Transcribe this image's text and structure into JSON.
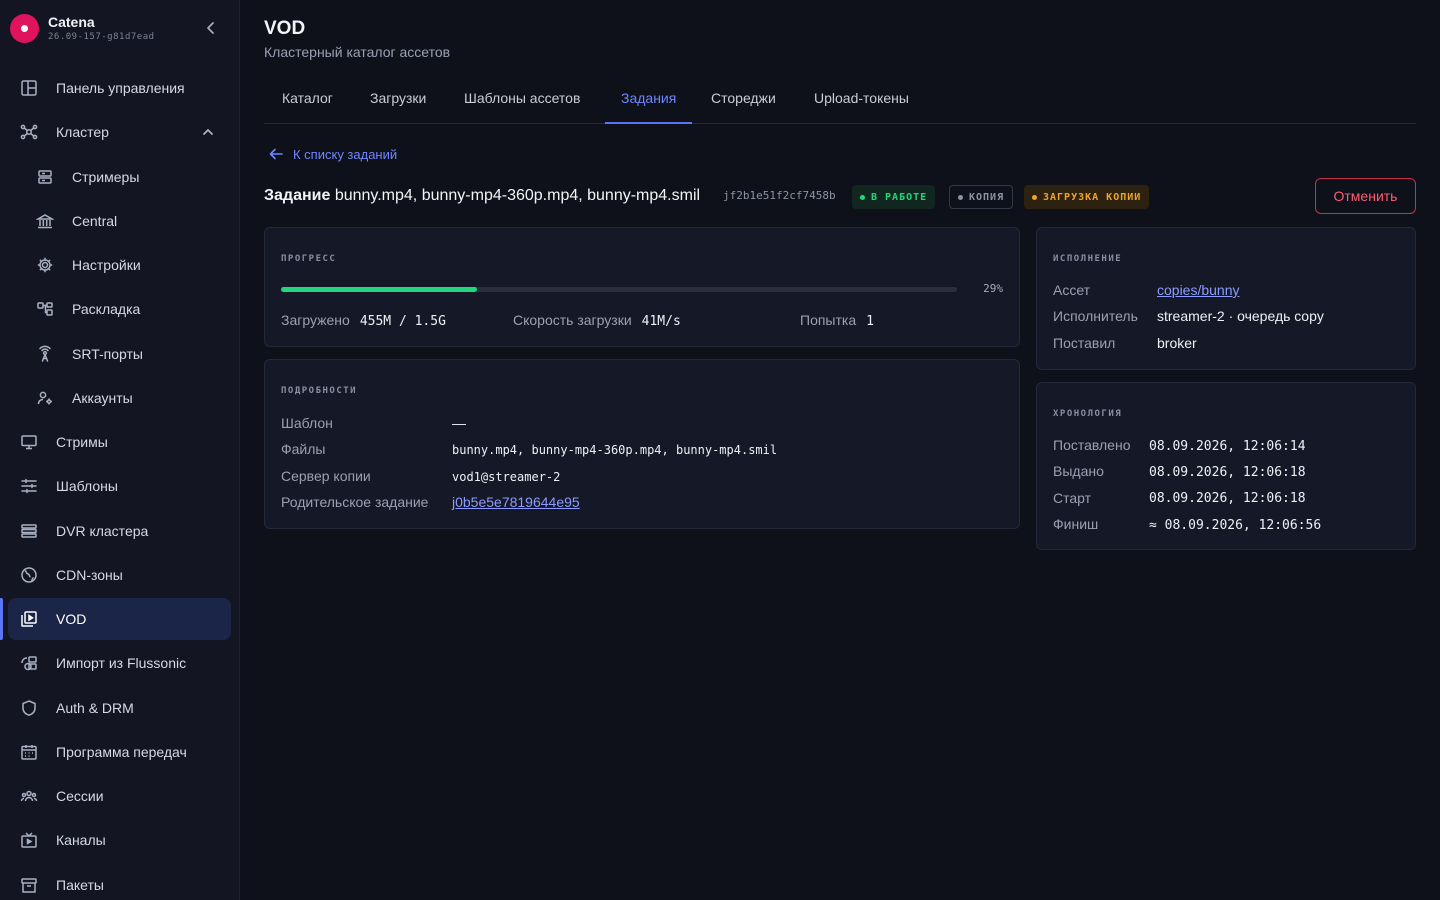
{
  "brand": {
    "name": "Catena",
    "version": "26.09-157-g81d7ead"
  },
  "sidebar": {
    "items": [
      {
        "label": "Панель управления",
        "icon": "dashboard-icon"
      },
      {
        "label": "Кластер",
        "icon": "cluster-icon"
      },
      {
        "label": "Стримеры",
        "icon": "server-icon"
      },
      {
        "label": "Central",
        "icon": "bank-icon"
      },
      {
        "label": "Настройки",
        "icon": "gear-icon"
      },
      {
        "label": "Раскладка",
        "icon": "layout-icon"
      },
      {
        "label": "SRT-порты",
        "icon": "antenna-icon"
      },
      {
        "label": "Аккаунты",
        "icon": "accounts-icon"
      },
      {
        "label": "Стримы",
        "icon": "monitor-icon"
      },
      {
        "label": "Шаблоны",
        "icon": "sliders-icon"
      },
      {
        "label": "DVR кластера",
        "icon": "dvr-icon"
      },
      {
        "label": "CDN-зоны",
        "icon": "globe-icon"
      },
      {
        "label": "VOD",
        "icon": "vod-icon"
      },
      {
        "label": "Импорт из Flussonic",
        "icon": "import-icon"
      },
      {
        "label": "Auth & DRM",
        "icon": "shield-icon"
      },
      {
        "label": "Программа передач",
        "icon": "calendar-icon"
      },
      {
        "label": "Сессии",
        "icon": "users-icon"
      },
      {
        "label": "Каналы",
        "icon": "tv-icon"
      },
      {
        "label": "Пакеты",
        "icon": "archive-icon"
      }
    ]
  },
  "header": {
    "title": "VOD",
    "subtitle": "Кластерный каталог ассетов"
  },
  "tabs": [
    {
      "label": "Каталог"
    },
    {
      "label": "Загрузки"
    },
    {
      "label": "Шаблоны ассетов"
    },
    {
      "label": "Задания"
    },
    {
      "label": "Стореджи"
    },
    {
      "label": "Upload-токены"
    }
  ],
  "back_link": "К списку заданий",
  "job": {
    "prefix": "Задание",
    "name": "bunny.mp4, bunny-mp4-360p.mp4, bunny-mp4.smil",
    "id": "jf2b1e51f2cf7458b",
    "badges": {
      "working": "В РАБОТЕ",
      "copy": "КОПИЯ",
      "loading": "ЗАГРУЗКА КОПИИ"
    },
    "cancel_label": "Отменить"
  },
  "progress": {
    "label": "ПРОГРЕСС",
    "percent": 29,
    "percent_text": "29%",
    "loaded_label": "Загружено",
    "loaded_value": "455M / 1.5G",
    "speed_label": "Скорость загрузки",
    "speed_value": "41M/s",
    "attempt_label": "Попытка",
    "attempt_value": "1"
  },
  "details": {
    "label": "ПОДРОБНОСТИ",
    "template_label": "Шаблон",
    "template_value": "—",
    "files_label": "Файлы",
    "files_value": "bunny.mp4, bunny-mp4-360p.mp4, bunny-mp4.smil",
    "server_label": "Сервер копии",
    "server_value": "vod1@streamer-2",
    "parent_label": "Родительское задание",
    "parent_value": "j0b5e5e7819644e95"
  },
  "execution": {
    "label": "ИСПОЛНЕНИЕ",
    "asset_label": "Ассет",
    "asset_value": "copies/bunny",
    "executor_label": "Исполнитель",
    "executor_value": "streamer-2 · очередь copy",
    "placed_by_label": "Поставил",
    "placed_by_value": "broker"
  },
  "timeline": {
    "label": "ХРОНОЛОГИЯ",
    "queued_label": "Поставлено",
    "queued_value": "08.09.2026, 12:06:14",
    "issued_label": "Выдано",
    "issued_value": "08.09.2026, 12:06:18",
    "start_label": "Старт",
    "start_value": "08.09.2026, 12:06:18",
    "finish_label": "Финиш",
    "finish_value": "≈ 08.09.2026, 12:06:56"
  },
  "colors": {
    "accent": "#5a74f2",
    "success": "#22d67b",
    "warning": "#f0a429",
    "danger": "#ff5c74",
    "background": "#0f111a"
  }
}
